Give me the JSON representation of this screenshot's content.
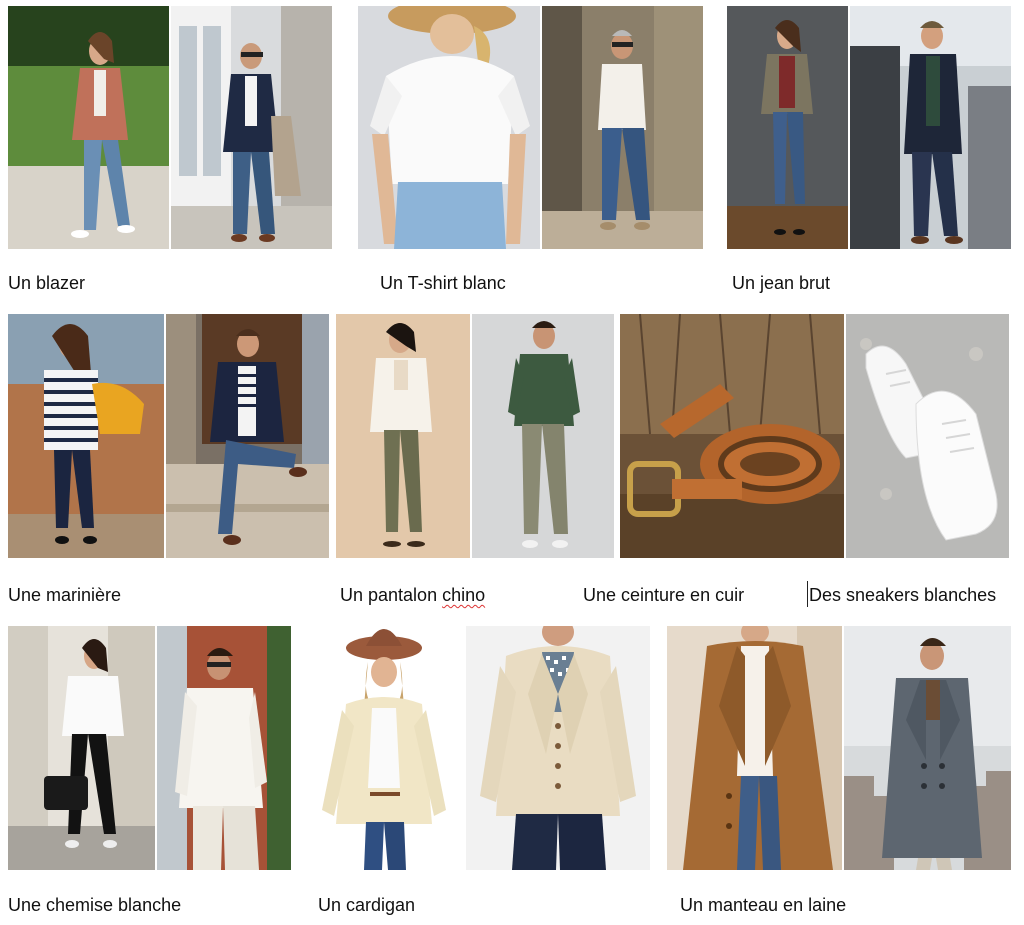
{
  "captions": {
    "blazer": "Un blazer",
    "tshirt": "Un T-shirt blanc",
    "jean": "Un jean brut",
    "mariniere": "Une marinière",
    "chino_prefix": "Un pantalon ",
    "chino_word": "chino",
    "ceinture": "Une ceinture en cuir",
    "sneakers": "Des sneakers blanches",
    "chemise": "Une chemise blanche",
    "cardigan": "Un cardigan",
    "manteau": "Un manteau en laine"
  },
  "colors": {
    "spellcheck_underline": "#dd3333"
  }
}
